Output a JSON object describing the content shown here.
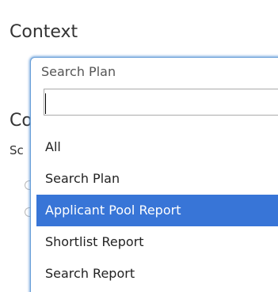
{
  "heading": "Context",
  "background_heading_fragment": "Co",
  "background_label_fragment": "Sc",
  "select": {
    "selected_value": "Search Plan",
    "search_value": "",
    "options": [
      "All",
      "Search Plan",
      "Applicant Pool Report",
      "Shortlist Report",
      "Search Report"
    ],
    "highlighted_index": 2,
    "highlight_color": "#3875d7",
    "focus_border_color": "#6aa0d8"
  }
}
